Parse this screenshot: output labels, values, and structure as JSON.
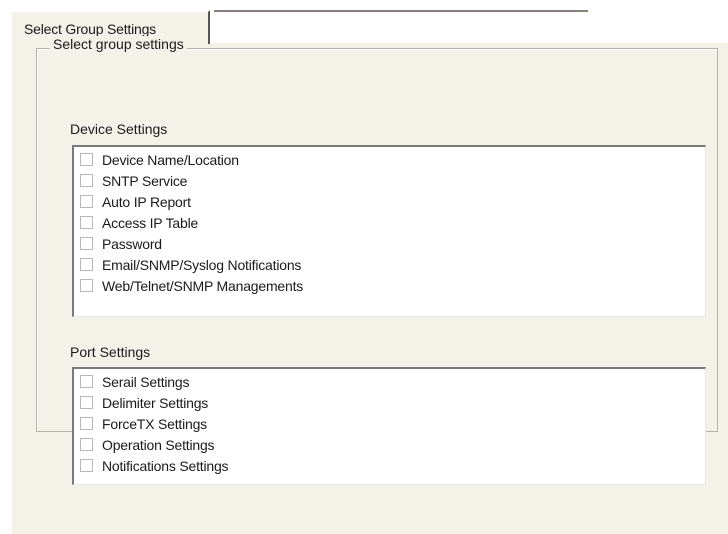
{
  "tab": {
    "label": "Select Group Settings"
  },
  "group": {
    "title": "Select group settings"
  },
  "device_settings": {
    "label": "Device Settings",
    "items": [
      {
        "label": "Device Name/Location",
        "checked": false
      },
      {
        "label": "SNTP Service",
        "checked": false
      },
      {
        "label": "Auto IP Report",
        "checked": false
      },
      {
        "label": "Access IP Table",
        "checked": false
      },
      {
        "label": "Password",
        "checked": false
      },
      {
        "label": "Email/SNMP/Syslog Notifications",
        "checked": false
      },
      {
        "label": "Web/Telnet/SNMP Managements",
        "checked": false
      }
    ]
  },
  "port_settings": {
    "label": "Port Settings",
    "items": [
      {
        "label": "Serail Settings",
        "checked": false
      },
      {
        "label": "Delimiter Settings",
        "checked": false
      },
      {
        "label": "ForceTX Settings",
        "checked": false
      },
      {
        "label": "Operation Settings",
        "checked": false
      },
      {
        "label": "Notifications Settings",
        "checked": false
      }
    ]
  }
}
